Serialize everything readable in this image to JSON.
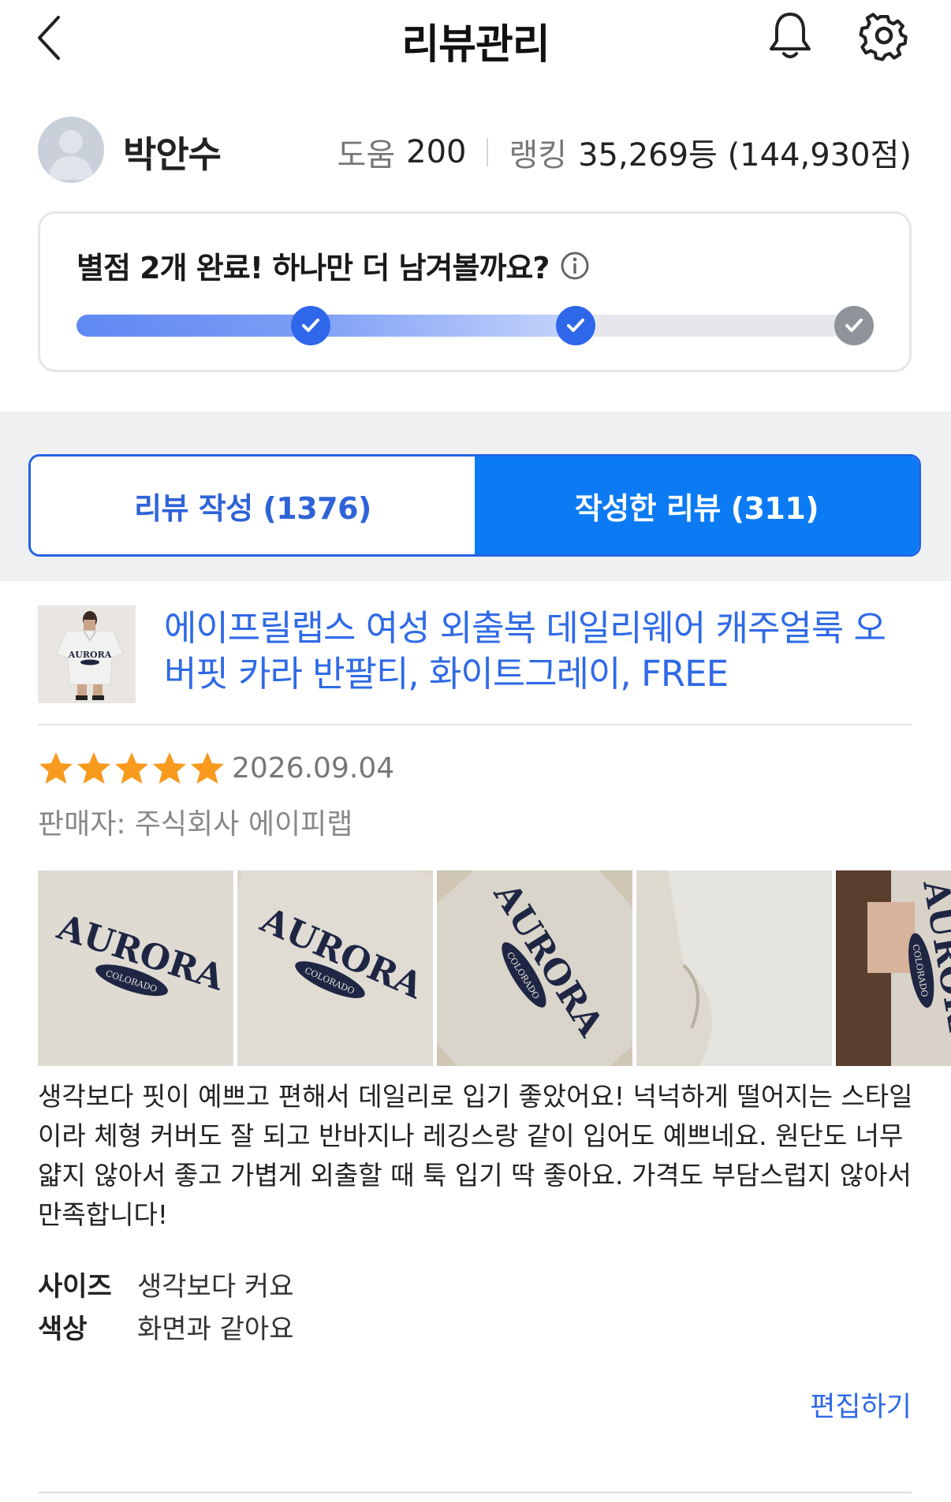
{
  "header": {
    "title": "리뷰관리",
    "back_icon": "chevron-left-icon",
    "bell_icon": "bell-icon",
    "settings_icon": "gear-icon"
  },
  "profile": {
    "name": "박안수",
    "help_label": "도움",
    "help_value": "200",
    "rank_label": "랭킹",
    "rank_value": "35,269등 (144,930점)"
  },
  "progress": {
    "message": "별점 2개 완료! 하나만 더 남겨볼까요?",
    "completed_steps": 2,
    "total_steps": 3,
    "colors": {
      "done": "#2f67ea",
      "todo": "#8f939a",
      "track": "#e5e7ea"
    }
  },
  "tabs": [
    {
      "label": "리뷰 작성 (1376)",
      "active": false
    },
    {
      "label": "작성한 리뷰 (311)",
      "active": true
    }
  ],
  "review": {
    "product_name": "에이프릴랩스 여성 외출복 데일리웨어 캐주얼룩 오버핏 카라 반팔티, 화이트그레이, FREE",
    "rating": 5,
    "rating_max": 5,
    "date": "2026.09.04",
    "seller": "판매자: 주식회사 에이피랩",
    "photo_count_visible": 5,
    "photo_print": "AURORA",
    "photo_print_sub": "COLORADO",
    "text": "생각보다 핏이 예쁘고 편해서 데일리로 입기 좋았어요! 넉넉하게 떨어지는 스타일이라 체형 커버도 잘 되고 반바지나 레깅스랑 같이 입어도 예쁘네요. 원단도 너무 얇지 않아서 좋고 가볍게 외출할 때 툭 입기 딱 좋아요. 가격도 부담스럽지 않아서 만족합니다!",
    "attributes": [
      {
        "key": "사이즈",
        "value": "생각보다 커요"
      },
      {
        "key": "색상",
        "value": "화면과 같아요"
      }
    ],
    "edit_label": "편집하기"
  },
  "colors": {
    "accent_blue": "#0c7bf3",
    "link_blue": "#2f6ae6",
    "star": "#f79a1e"
  }
}
